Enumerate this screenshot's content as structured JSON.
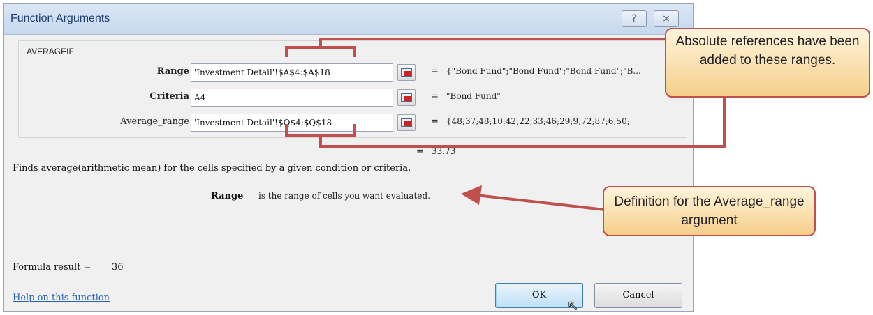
{
  "dialog": {
    "title": "Function Arguments",
    "help_button": "?",
    "close_button": "×",
    "function_name": "AVERAGEIF",
    "arguments": [
      {
        "label": "Range",
        "bold": true,
        "input": "'Investment Detail'!$A$4:$A$18",
        "value": "{\"Bond Fund\";\"Bond Fund\";\"Bond Fund\";\"B..."
      },
      {
        "label": "Criteria",
        "bold": true,
        "input": "A4",
        "value": "\"Bond Fund\""
      },
      {
        "label": "Average_range",
        "bold": false,
        "input": "'Investment Detail'!$Q$4:$Q$18",
        "value": "{48;37;48;10;42;22;33;46;29;9;72;87;6;50;"
      }
    ],
    "equals": "=",
    "result_value": "33.73",
    "description": "Finds average(arithmetic mean) for the cells specified by a given condition or criteria.",
    "argument_help": {
      "name": "Range",
      "text": "is the range of cells you want evaluated."
    },
    "formula_result_label": "Formula result =",
    "formula_result_value": "36",
    "help_link": "Help on this function",
    "ok_label": "OK",
    "cancel_label": "Cancel"
  },
  "callouts": {
    "absolute_refs": "Absolute references have been added to these ranges.",
    "definition": "Definition for the Average_range argument"
  },
  "colors": {
    "annotation": "#c0504d",
    "accent": "#3c7fb1"
  }
}
